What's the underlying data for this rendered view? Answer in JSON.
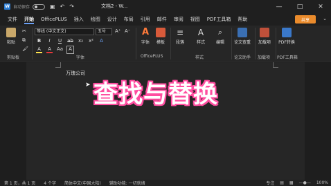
{
  "titlebar": {
    "autosave_label": "自动保存",
    "doc_title": "文档2 - W...",
    "minimize": "—",
    "maximize": "□",
    "close": "✕"
  },
  "tabs": [
    "文件",
    "开始",
    "OfficePLUS",
    "插入",
    "绘图",
    "设计",
    "布局",
    "引用",
    "邮件",
    "审阅",
    "视图",
    "PDF工具箱",
    "帮助"
  ],
  "active_tab": "开始",
  "share_label": "共享",
  "ribbon": {
    "paste_label": "粘贴",
    "clipboard_group": "剪贴板",
    "font_name": "等线 (中文正文)",
    "font_size": "五号",
    "font_group": "字体",
    "format_row1": [
      "B",
      "I",
      "U",
      "ab",
      "x₂",
      "x²",
      "A"
    ],
    "format_row2": [
      "A",
      "A",
      "Aa",
      "A"
    ],
    "font_btn_label": "字体",
    "template_btn_label": "模板",
    "officeplus_group": "OfficePLUS",
    "paragraph_label": "段落",
    "style_label": "样式",
    "edit_label": "编辑",
    "style_group": "样式",
    "thesis_check_label": "论文查重",
    "thesis_group": "论文助手",
    "addin_label": "加载项",
    "addin_group": "加载项",
    "pdf_convert_label": "PDF转换",
    "pdf_group": "PDF工具箱"
  },
  "document": {
    "text": "万瑰公司"
  },
  "overlay_title": "查找与替换",
  "status": {
    "page": "第 1 页，共 1 页",
    "words": "4 个字",
    "language": "简体中文(中国大陆)",
    "accessibility": "辅助功能: 一切就绪",
    "focus": "专注",
    "zoom": "100%"
  },
  "colors": {
    "accent_blue": "#6a9ff5",
    "share_orange": "#ea8b2c",
    "overlay_pink": "#ff4fa1"
  }
}
